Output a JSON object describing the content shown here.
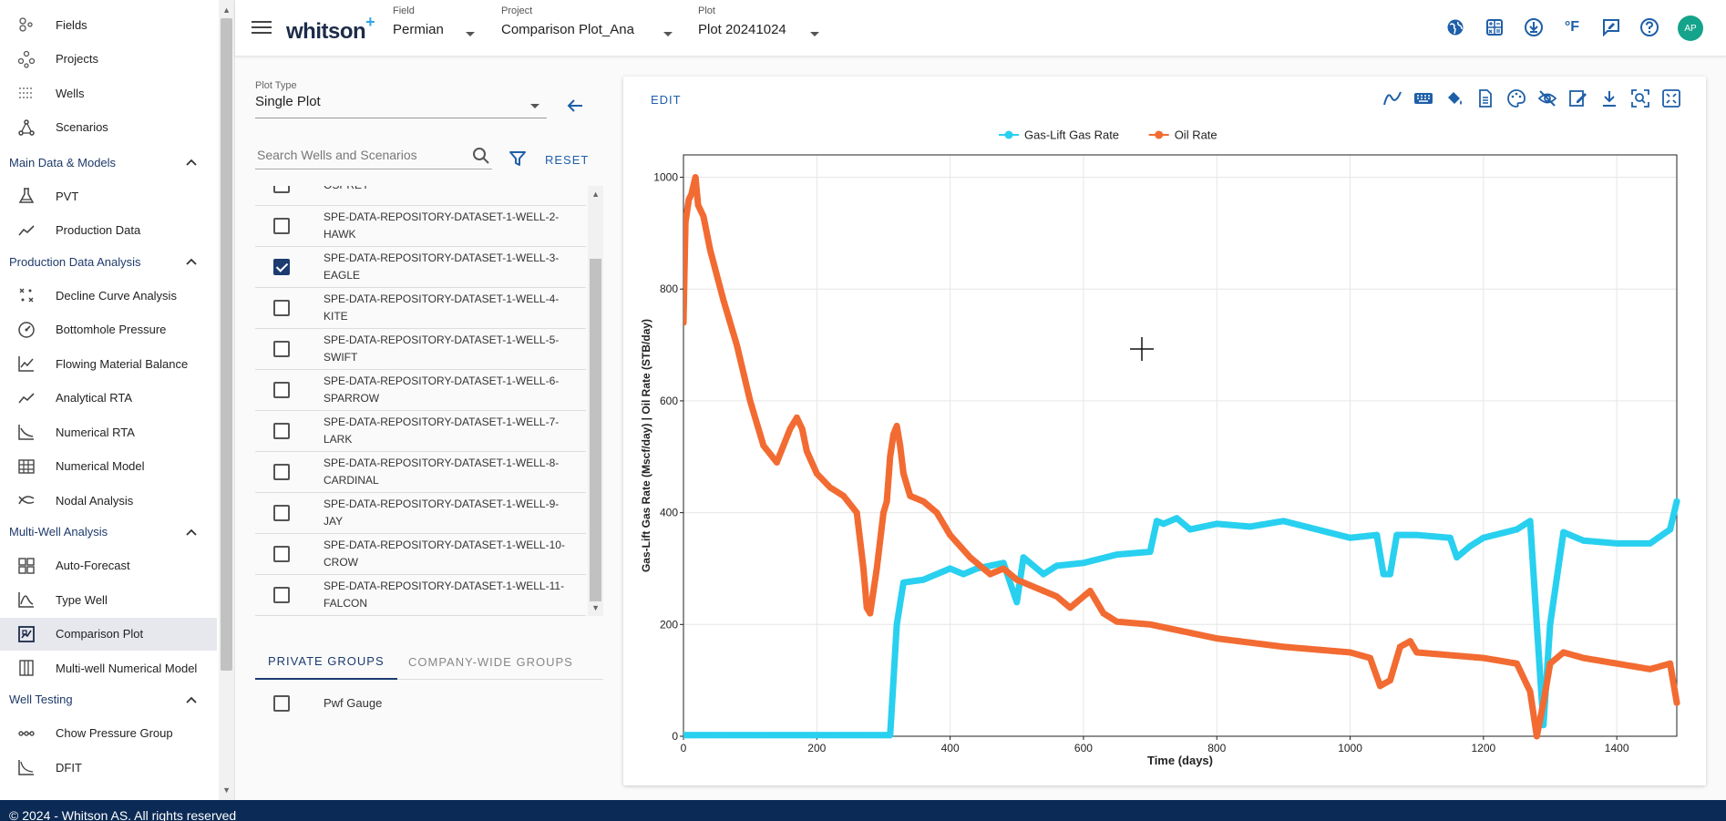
{
  "sidebar": {
    "top_items": [
      {
        "label": "Fields",
        "icon": "fields-icon"
      },
      {
        "label": "Projects",
        "icon": "projects-icon"
      },
      {
        "label": "Wells",
        "icon": "wells-icon"
      },
      {
        "label": "Scenarios",
        "icon": "scenarios-icon"
      }
    ],
    "sections": [
      {
        "label": "Main Data & Models",
        "items": [
          {
            "label": "PVT",
            "icon": "flask-icon"
          },
          {
            "label": "Production Data",
            "icon": "trend-line-icon"
          }
        ]
      },
      {
        "label": "Production Data Analysis",
        "items": [
          {
            "label": "Decline Curve Analysis",
            "icon": "decline-curve-icon"
          },
          {
            "label": "Bottomhole Pressure",
            "icon": "gauge-icon"
          },
          {
            "label": "Flowing Material Balance",
            "icon": "line-chart-icon"
          },
          {
            "label": "Analytical RTA",
            "icon": "trend-line-icon"
          },
          {
            "label": "Numerical RTA",
            "icon": "curve-icon"
          },
          {
            "label": "Numerical Model",
            "icon": "grid-icon"
          },
          {
            "label": "Nodal Analysis",
            "icon": "nodal-icon"
          }
        ]
      },
      {
        "label": "Multi-Well Analysis",
        "items": [
          {
            "label": "Auto-Forecast",
            "icon": "dashboard-icon"
          },
          {
            "label": "Type Well",
            "icon": "type-curve-icon"
          },
          {
            "label": "Comparison Plot",
            "icon": "comparison-icon",
            "active": true
          },
          {
            "label": "Multi-well Numerical Model",
            "icon": "columns-icon"
          }
        ]
      },
      {
        "label": "Well Testing",
        "items": [
          {
            "label": "Chow Pressure Group",
            "icon": "chain-icon"
          },
          {
            "label": "DFIT",
            "icon": "dfit-icon"
          }
        ]
      }
    ]
  },
  "header": {
    "logo": "whitson",
    "logo_plus": "+",
    "field": {
      "label": "Field",
      "value": "Permian"
    },
    "project": {
      "label": "Project",
      "value": "Comparison Plot_Ana"
    },
    "plot": {
      "label": "Plot",
      "value": "Plot 20241024"
    },
    "temp_unit": "°F",
    "avatar": "AP",
    "icons": [
      "globe-icon",
      "calculator-icon",
      "download-circle-icon",
      "temperature-unit-icon",
      "feedback-icon",
      "help-icon"
    ]
  },
  "left_panel": {
    "plot_type_label": "Plot Type",
    "plot_type_value": "Single Plot",
    "search_placeholder": "Search Wells and Scenarios",
    "reset_label": "RESET",
    "wells": [
      {
        "name": "OSPREY",
        "checked": false,
        "partial": true
      },
      {
        "name": "SPE-DATA-REPOSITORY-DATASET-1-WELL-2-HAWK",
        "checked": false
      },
      {
        "name": "SPE-DATA-REPOSITORY-DATASET-1-WELL-3-EAGLE",
        "checked": true
      },
      {
        "name": "SPE-DATA-REPOSITORY-DATASET-1-WELL-4-KITE",
        "checked": false
      },
      {
        "name": "SPE-DATA-REPOSITORY-DATASET-1-WELL-5-SWIFT",
        "checked": false
      },
      {
        "name": "SPE-DATA-REPOSITORY-DATASET-1-WELL-6-SPARROW",
        "checked": false
      },
      {
        "name": "SPE-DATA-REPOSITORY-DATASET-1-WELL-7-LARK",
        "checked": false
      },
      {
        "name": "SPE-DATA-REPOSITORY-DATASET-1-WELL-8-CARDINAL",
        "checked": false
      },
      {
        "name": "SPE-DATA-REPOSITORY-DATASET-1-WELL-9-JAY",
        "checked": false
      },
      {
        "name": "SPE-DATA-REPOSITORY-DATASET-1-WELL-10-CROW",
        "checked": false
      },
      {
        "name": "SPE-DATA-REPOSITORY-DATASET-1-WELL-11-FALCON",
        "checked": false
      }
    ],
    "group_tabs": {
      "private": "PRIVATE GROUPS",
      "company": "COMPANY-WIDE GROUPS"
    },
    "groups": [
      {
        "name": "Pwf Gauge",
        "checked": false
      }
    ]
  },
  "chart_card": {
    "edit_label": "EDIT",
    "toolbar_icons": [
      "smooth-curve-icon",
      "keyboard-icon",
      "fill-icon",
      "document-icon",
      "palette-icon",
      "hide-icon",
      "edit-note-icon",
      "download-icon",
      "zoom-icon",
      "fit-icon"
    ]
  },
  "chart_data": {
    "type": "scatter",
    "title": "",
    "xlabel": "Time (days)",
    "ylabel": "Gas-Lift Gas Rate (Mscf/day) | Oil Rate (STB/day)",
    "xlim": [
      0,
      1490
    ],
    "ylim": [
      0,
      1040
    ],
    "x_ticks": [
      0,
      200,
      400,
      600,
      800,
      1000,
      1200,
      1400
    ],
    "y_ticks": [
      0,
      200,
      400,
      600,
      800,
      1000
    ],
    "grid": true,
    "legend_position": "top-center",
    "series": [
      {
        "name": "Gas-Lift Gas Rate",
        "color": "#29d0ef",
        "x": [
          0,
          300,
          310,
          315,
          320,
          330,
          360,
          380,
          400,
          420,
          440,
          480,
          500,
          510,
          520,
          540,
          560,
          600,
          650,
          700,
          710,
          720,
          740,
          760,
          800,
          850,
          900,
          950,
          1000,
          1040,
          1050,
          1060,
          1070,
          1100,
          1150,
          1160,
          1180,
          1200,
          1250,
          1270,
          1280,
          1290,
          1300,
          1320,
          1350,
          1400,
          1450,
          1480,
          1490
        ],
        "y": [
          2,
          2,
          2,
          100,
          200,
          275,
          280,
          290,
          300,
          290,
          300,
          310,
          240,
          320,
          310,
          290,
          305,
          310,
          325,
          330,
          385,
          380,
          390,
          370,
          380,
          375,
          385,
          370,
          355,
          360,
          290,
          290,
          360,
          360,
          355,
          320,
          340,
          355,
          370,
          385,
          200,
          20,
          200,
          365,
          350,
          345,
          345,
          370,
          420
        ]
      },
      {
        "name": "Oil Rate",
        "color": "#f26b32",
        "x": [
          0,
          3,
          8,
          12,
          18,
          22,
          30,
          40,
          60,
          80,
          100,
          120,
          140,
          160,
          170,
          178,
          185,
          200,
          220,
          240,
          260,
          270,
          275,
          280,
          290,
          300,
          305,
          310,
          315,
          320,
          325,
          330,
          340,
          360,
          380,
          400,
          430,
          460,
          480,
          500,
          520,
          540,
          560,
          580,
          600,
          610,
          630,
          650,
          700,
          800,
          900,
          1000,
          1030,
          1045,
          1060,
          1075,
          1090,
          1100,
          1150,
          1200,
          1250,
          1270,
          1280,
          1290,
          1300,
          1320,
          1350,
          1400,
          1450,
          1480,
          1490
        ],
        "y": [
          740,
          920,
          960,
          970,
          1000,
          950,
          930,
          870,
          780,
          700,
          600,
          520,
          490,
          550,
          570,
          550,
          510,
          470,
          445,
          430,
          400,
          300,
          230,
          220,
          300,
          400,
          420,
          500,
          540,
          555,
          520,
          470,
          430,
          420,
          400,
          360,
          320,
          290,
          300,
          280,
          270,
          260,
          250,
          230,
          250,
          260,
          220,
          205,
          200,
          175,
          160,
          150,
          140,
          90,
          100,
          160,
          170,
          150,
          145,
          140,
          130,
          80,
          0,
          60,
          130,
          150,
          140,
          130,
          120,
          130,
          60
        ]
      }
    ]
  },
  "footer": {
    "text": "© 2024 - Whitson AS. All rights reserved"
  }
}
